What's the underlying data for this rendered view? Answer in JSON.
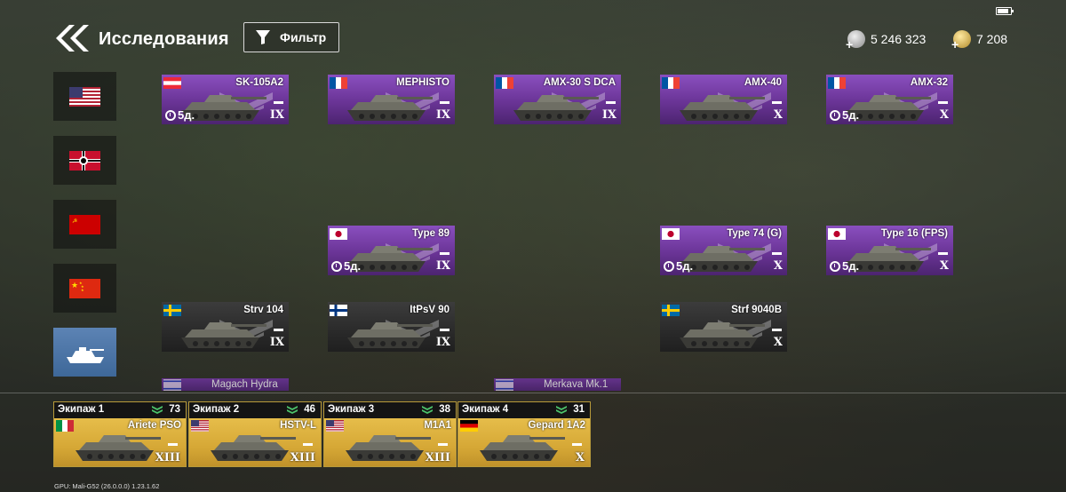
{
  "header": {
    "title": "Исследования",
    "filter_label": "Фильтр"
  },
  "currencies": {
    "silver": "5 246 323",
    "gold": "7 208"
  },
  "nations": [
    {
      "id": "usa",
      "active": false
    },
    {
      "id": "germany",
      "active": false
    },
    {
      "id": "ussr",
      "active": false
    },
    {
      "id": "china",
      "active": false
    },
    {
      "id": "mixed",
      "active": true
    }
  ],
  "vehicles": [
    {
      "name": "SK-105A2",
      "flag": "austria",
      "rank": "IX",
      "timer": "5д.",
      "style": "purple"
    },
    {
      "name": "MEPHISTO",
      "flag": "france",
      "rank": "IX",
      "timer": "",
      "style": "purple"
    },
    {
      "name": "AMX-30 S DCA",
      "flag": "france",
      "rank": "IX",
      "timer": "",
      "style": "purple"
    },
    {
      "name": "AMX-40",
      "flag": "france",
      "rank": "X",
      "timer": "",
      "style": "purple"
    },
    {
      "name": "AMX-32",
      "flag": "france",
      "rank": "X",
      "timer": "5д.",
      "style": "purple"
    },
    {
      "name": "Type 89",
      "flag": "japan",
      "rank": "IX",
      "timer": "5д.",
      "style": "purple"
    },
    {
      "name": "Type 74 (G)",
      "flag": "japan",
      "rank": "X",
      "timer": "5д.",
      "style": "purple"
    },
    {
      "name": "Type 16 (FPS)",
      "flag": "japan",
      "rank": "X",
      "timer": "5д.",
      "style": "purple"
    },
    {
      "name": "Strv 104",
      "flag": "sweden",
      "rank": "IX",
      "timer": "",
      "style": "dark"
    },
    {
      "name": "ItPsV 90",
      "flag": "finland",
      "rank": "IX",
      "timer": "",
      "style": "dark"
    },
    {
      "name": "Strf 9040B",
      "flag": "sweden",
      "rank": "X",
      "timer": "",
      "style": "dark"
    }
  ],
  "peek_vehicles": [
    {
      "name": "Magach Hydra",
      "flag": "israel"
    },
    {
      "name": "Merkava Mk.1",
      "flag": "israel"
    }
  ],
  "crews": [
    {
      "label": "Экипаж 1",
      "level": "73",
      "vehicle": "Ariete PSO",
      "flag": "italy",
      "rank": "XIII"
    },
    {
      "label": "Экипаж 2",
      "level": "46",
      "vehicle": "HSTV-L",
      "flag": "usa",
      "rank": "XIII"
    },
    {
      "label": "Экипаж 3",
      "level": "38",
      "vehicle": "M1A1",
      "flag": "usa",
      "rank": "XIII"
    },
    {
      "label": "Экипаж 4",
      "level": "31",
      "vehicle": "Gepard 1A2",
      "flag": "germany",
      "rank": "X"
    }
  ],
  "footer": {
    "gpu_info": "GPU: Mali-G52 (26.0.0.0)    1.23.1.62"
  },
  "colors": {
    "premium_purple": "#6a3496",
    "crew_gold": "#d6a836",
    "nation_active": "#4a75a8"
  }
}
